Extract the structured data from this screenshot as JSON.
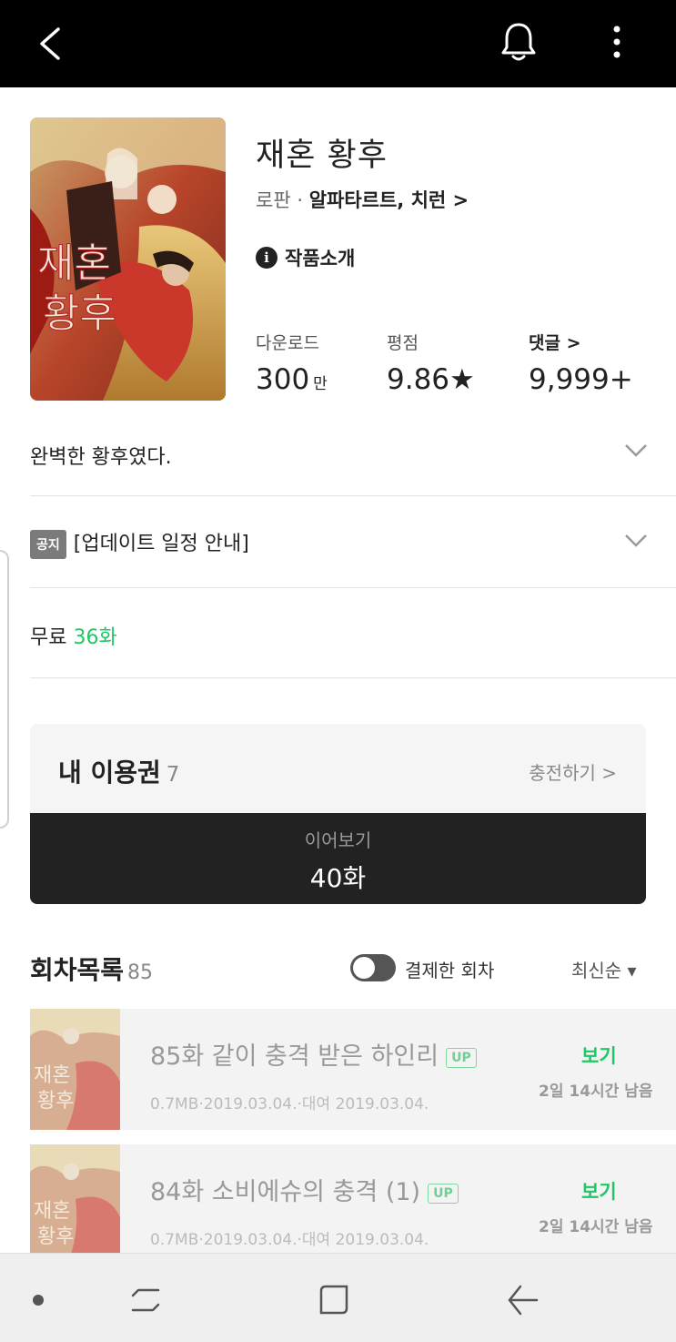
{
  "header": {
    "back_icon": "back-arrow-icon",
    "bell_icon": "bell-icon",
    "more_icon": "more-vertical-icon"
  },
  "work": {
    "title": "재혼 황후",
    "genre": "로판 ·",
    "authors": "알파타르트, 치런 >",
    "intro_label": "작품소개",
    "cover_text": "재혼황후"
  },
  "stats": {
    "download_label": "다운로드",
    "download_value": "300",
    "download_unit": "만",
    "rating_label": "평점",
    "rating_value": "9.86★",
    "comments_label": "댓글 >",
    "comments_value": "9,999+"
  },
  "synopsis": "완벽한 황후였다.",
  "notice": {
    "tag": "공지",
    "text": "[업데이트 일정 안내]"
  },
  "free": {
    "label": "무료",
    "value": "36화"
  },
  "pass": {
    "title": "내 이용권",
    "count": "7",
    "charge_label": "충전하기 >",
    "continue_label": "이어보기",
    "continue_episode": "40화"
  },
  "episode_list": {
    "title": "회차목록",
    "count": "85",
    "toggle_label": "결제한 회차",
    "sort_label": "최신순 ▾",
    "episodes": [
      {
        "title": "85화 같이 충격 받은 하인리",
        "badge": "UP",
        "meta": "0.7MB·2019.03.04.·대여 2019.03.04.",
        "action": "보기",
        "remaining": "2일 14시간 남음"
      },
      {
        "title": "84화 소비에슈의 충격 (1)",
        "badge": "UP",
        "meta": "0.7MB·2019.03.04.·대여 2019.03.04.",
        "action": "보기",
        "remaining": "2일 14시간 남음"
      }
    ]
  },
  "colors": {
    "accent_green": "#1ec864",
    "header_bg": "#000000",
    "continue_bg": "#222222"
  }
}
